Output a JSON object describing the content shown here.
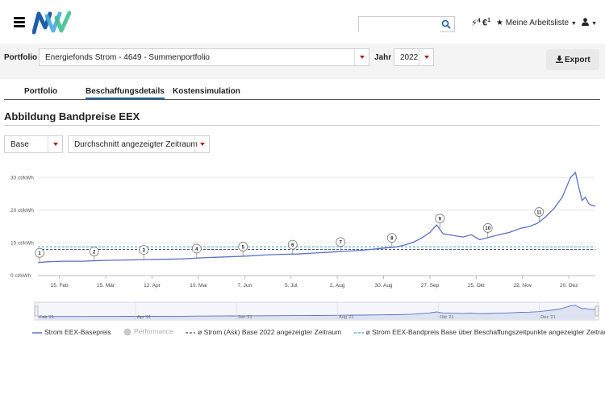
{
  "header": {
    "search": {
      "value": "",
      "placeholder": ""
    },
    "icon_badge_1": "4",
    "icon_badge_2": "1",
    "watchlist_label": "Meine Arbeitsliste",
    "brand_colors": {
      "blue": "#1e5fa8",
      "green": "#3fbf8f",
      "light_blue": "#4aa8e0"
    }
  },
  "toolbar": {
    "portfolio_label": "Portfolio",
    "portfolio_value": "Energiefonds Strom - 4649 - Summenportfolio",
    "year_label": "Jahr",
    "year_value": "2022",
    "export_label": "Export"
  },
  "tabs": [
    {
      "label": "Portfolio",
      "active": false
    },
    {
      "label": "Beschaffungsdetails",
      "active": true
    },
    {
      "label": "Kostensimulation",
      "active": false
    }
  ],
  "section": {
    "title": "Abbildung Bandpreise EEX",
    "product_select": "Base",
    "period_select": "Durchschnitt angezeigter Zeitraum"
  },
  "chart_data": {
    "type": "line",
    "y_unit_ticks": [
      "30 ct/kWh",
      "20 ct/kWh",
      "10 ct/kWh",
      "0 ct/kWh"
    ],
    "y_ticks": [
      30,
      20,
      10,
      0
    ],
    "ylim": [
      0,
      35
    ],
    "x_ticks": [
      "15. Feb",
      "15. Mär",
      "12. Apr",
      "10. Mai",
      "7. Jun",
      "5. Jul",
      "2. Aug",
      "30. Aug",
      "27. Sep",
      "25. Okt",
      "22. Nov",
      "20. Dez"
    ],
    "x_tick_days": [
      46,
      74,
      102,
      130,
      158,
      186,
      214,
      242,
      270,
      298,
      326,
      354
    ],
    "xlim_days": [
      33,
      370
    ],
    "navigator_labels": [
      "Feb '21",
      "Apr '21",
      "Jun '21",
      "Aug '21",
      "Okt '21",
      "Dez '21"
    ],
    "navigator_label_days": [
      33,
      92,
      153,
      214,
      275,
      336
    ],
    "series": [
      {
        "name": "Strom EEX-Basepreis",
        "color": "#5b6fc4",
        "days": [
          33,
          40,
          50,
          60,
          70,
          80,
          90,
          100,
          110,
          120,
          130,
          140,
          150,
          160,
          170,
          180,
          190,
          200,
          210,
          220,
          230,
          240,
          250,
          255,
          260,
          265,
          270,
          274,
          278,
          285,
          290,
          295,
          300,
          305,
          310,
          318,
          325,
          330,
          335,
          340,
          345,
          350,
          355,
          358,
          360,
          362,
          364,
          366,
          368,
          370
        ],
        "values": [
          4.0,
          4.3,
          4.4,
          4.4,
          4.6,
          4.7,
          4.8,
          4.9,
          5.0,
          5.1,
          5.4,
          5.6,
          5.8,
          6.0,
          6.3,
          6.5,
          6.6,
          6.9,
          7.2,
          7.5,
          7.8,
          8.3,
          8.8,
          9.4,
          10.2,
          11.5,
          13.2,
          15.5,
          12.8,
          12.2,
          11.8,
          12.5,
          11.0,
          11.6,
          12.3,
          13.2,
          14.5,
          15.0,
          16.0,
          18.0,
          20.5,
          24.0,
          30.0,
          31.5,
          27.0,
          23.0,
          24.0,
          22.0,
          21.5,
          21.2
        ]
      },
      {
        "name": "Performance",
        "color": "#b0b0b0"
      },
      {
        "name": "ø Strom (Ask) Base 2022 angezeigter Zeitraum",
        "color": "#3d4f8a",
        "value": 8.0
      },
      {
        "name": "ø Strom EEX-Bandpreis Base über Beschaffungszeitpunkte angezeigter Zeitraum",
        "color": "#3aa6a6",
        "value": 8.8
      }
    ],
    "markers": [
      {
        "label": "1",
        "day": 34,
        "value": 4.0
      },
      {
        "label": "2",
        "day": 67,
        "value": 4.4
      },
      {
        "label": "3",
        "day": 97,
        "value": 4.9
      },
      {
        "label": "4",
        "day": 129,
        "value": 5.3
      },
      {
        "label": "5",
        "day": 157,
        "value": 5.9
      },
      {
        "label": "6",
        "day": 187,
        "value": 6.5
      },
      {
        "label": "7",
        "day": 216,
        "value": 7.3
      },
      {
        "label": "8",
        "day": 247,
        "value": 8.6
      },
      {
        "label": "9",
        "day": 276,
        "value": 14.5
      },
      {
        "label": "10",
        "day": 305,
        "value": 11.6
      },
      {
        "label": "11",
        "day": 336,
        "value": 16.5
      }
    ]
  }
}
